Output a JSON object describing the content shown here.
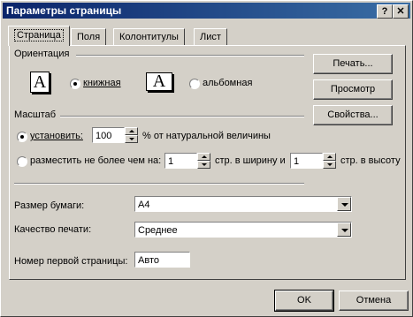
{
  "window": {
    "title": "Параметры страницы",
    "help_btn": "?",
    "close_btn": "✕"
  },
  "tabs": [
    "Страница",
    "Поля",
    "Колонтитулы",
    "Лист"
  ],
  "orientation": {
    "label": "Ориентация",
    "portrait_label": "книжная",
    "landscape_label": "альбомная",
    "portrait_icon_letter": "A",
    "landscape_icon_letter": "A",
    "selected": "portrait"
  },
  "scale": {
    "label": "Масштаб",
    "set_label": "установить:",
    "set_value": "100",
    "set_suffix": "% от натуральной величины",
    "fit_label": "разместить не более чем на:",
    "fit_width_value": "1",
    "fit_width_suffix": "стр. в ширину и",
    "fit_height_value": "1",
    "fit_height_suffix": "стр. в высоту",
    "selected": "set"
  },
  "paper": {
    "size_label": "Размер бумаги:",
    "size_value": "A4",
    "quality_label": "Качество печати:",
    "quality_value": "Среднее",
    "first_page_label": "Номер первой страницы:",
    "first_page_value": "Авто"
  },
  "side_buttons": {
    "print": "Печать...",
    "preview": "Просмотр",
    "properties": "Свойства..."
  },
  "footer": {
    "ok": "OK",
    "cancel": "Отмена"
  }
}
